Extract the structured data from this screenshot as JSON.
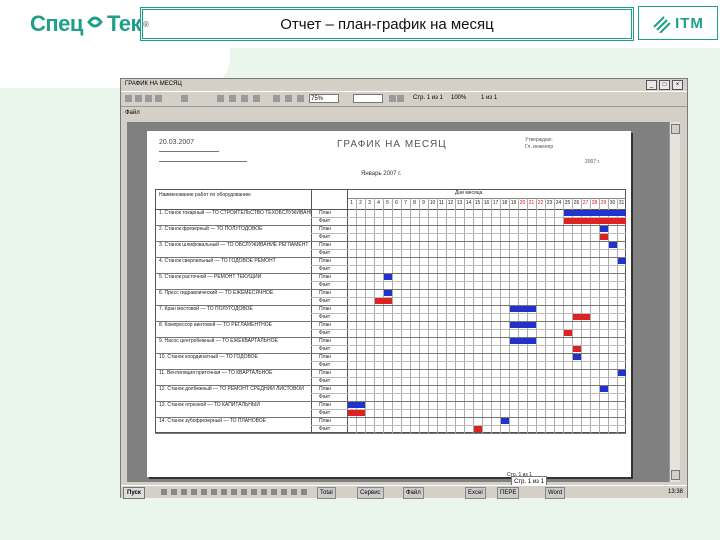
{
  "slide": {
    "logo_left": {
      "part1": "Спец",
      "part2": "Тек",
      "reg": "®"
    },
    "title": "Отчет – план-график на месяц",
    "logo_right": "ITM",
    "colors": {
      "brand": "#1e9f88",
      "mint": "#eaf6ec",
      "plan_bar": "#2233cc",
      "fact_bar": "#dd2222"
    }
  },
  "window": {
    "title": "ГРАФИК НА МЕСЯЦ",
    "controls": [
      "_",
      "□",
      "×"
    ],
    "toolbar": {
      "zoom": "75%",
      "page_info": "Стр. 1 из 1",
      "pos_a": "100%",
      "pos_b": "1 из 1"
    },
    "menu_label": "Файл"
  },
  "report": {
    "header_date": "20.03.2007",
    "title": "ГРАФИК НА МЕСЯЦ",
    "right_line1": "Утверждаю:",
    "right_line2": "Гл. инженер",
    "right_line3": "2007 г.",
    "month": "Январь 2007 г.",
    "col_task_header": "Наименование работ по оборудованию",
    "col_days_header": "Дни месяца",
    "days": [
      "1",
      "2",
      "3",
      "4",
      "5",
      "6",
      "7",
      "8",
      "9",
      "10",
      "11",
      "12",
      "13",
      "14",
      "15",
      "16",
      "17",
      "18",
      "19",
      "20",
      "21",
      "22",
      "23",
      "24",
      "25",
      "26",
      "27",
      "28",
      "29",
      "30",
      "31"
    ],
    "weekend_days": [
      "20",
      "21",
      "22",
      "27",
      "28",
      "29"
    ],
    "plan_label": "План",
    "fact_label": "Факт",
    "tasks": [
      {
        "label": "1. Станок токарный — ТО СТРОИТЕЛЬСТВО ТЕХОБСЛУЖИВАНИЕ",
        "plan": [
          25,
          31
        ],
        "fact": [
          25,
          31
        ]
      },
      {
        "label": "2. Станок фрезерный — ТО ПОЛУГОДОВОЕ",
        "plan": [
          29,
          29
        ],
        "fact": [
          29,
          29
        ]
      },
      {
        "label": "3. Станок шлифовальный — ТО ОБСЛУЖИВАНИЕ РЕГЛАМЕНТ",
        "plan": [
          30,
          30
        ],
        "fact": null
      },
      {
        "label": "4. Станок сверлильный — ТО ГОДОВОЕ РЕМОНТ",
        "plan": [
          31,
          31
        ],
        "fact": null
      },
      {
        "label": "5. Станок расточной — РЕМОНТ ТЕКУЩИЙ",
        "plan": [
          5,
          5
        ],
        "fact": null
      },
      {
        "label": "6. Пресс гидравлический — ТО ЕЖЕМЕСЯЧНОЕ",
        "plan": [
          5,
          5
        ],
        "fact": [
          4,
          5
        ]
      },
      {
        "label": "7. Кран мостовой — ТО ПОЛУГОДОВОЕ",
        "plan": [
          19,
          21
        ],
        "fact": [
          26,
          27
        ]
      },
      {
        "label": "8. Компрессор винтовой — ТО РЕГЛАМЕНТНОЕ",
        "plan": [
          19,
          21
        ],
        "fact": [
          25,
          25
        ]
      },
      {
        "label": "9. Насос центробежный — ТО ЕЖЕКВАРТАЛЬНОЕ",
        "plan": [
          19,
          21
        ],
        "fact": [
          26,
          26
        ]
      },
      {
        "label": "10. Станок координатный — ТО ГОДОВОЕ",
        "plan": [
          26,
          26
        ],
        "fact": null
      },
      {
        "label": "11. Вентиляция приточная — ТО КВАРТАЛЬНОЕ",
        "plan": [
          31,
          31
        ],
        "fact": null
      },
      {
        "label": "12. Станок долбежный — ТО РЕМОНТ СРЕДНИЙ ЛИСТОВОЙ",
        "plan": [
          29,
          29
        ],
        "fact": null
      },
      {
        "label": "13. Станок отрезной — ТО КАПИТАЛЬНЫЙ",
        "plan": [
          1,
          2
        ],
        "fact": [
          1,
          2
        ]
      },
      {
        "label": "14. Станок зубофрезерный — ТО ПЛАНОВОЕ",
        "plan": [
          18,
          18
        ],
        "fact": [
          15,
          15
        ]
      }
    ],
    "page_footer": "Стр. 1 из 1"
  },
  "taskbar": {
    "start": "Пуск",
    "items": [
      "Total",
      "Сервис",
      "Файл",
      "Excel",
      "ПЕРЕ",
      "Word"
    ],
    "clock": "13:38"
  }
}
